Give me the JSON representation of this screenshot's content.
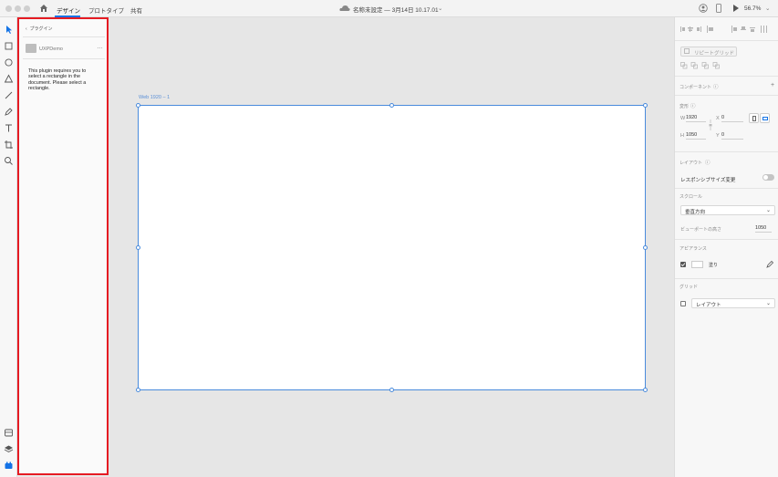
{
  "titlebar": {
    "tabs": [
      {
        "label": "デザイン",
        "active": true
      },
      {
        "label": "プロトタイプ",
        "active": false
      },
      {
        "label": "共有",
        "active": false
      }
    ],
    "doc_title": "名称未設定 — 3月14日 10.17.01",
    "zoom": "56.7%"
  },
  "toolbar": {
    "tools": [
      "select-icon",
      "rectangle-icon",
      "ellipse-icon",
      "polygon-icon",
      "line-icon",
      "pen-icon",
      "text-icon",
      "artboard-icon",
      "zoom-icon"
    ],
    "bottom_tools": [
      "assets-icon",
      "layers-icon",
      "plugins-icon"
    ]
  },
  "plugin_panel": {
    "back_label": "プラグイン",
    "plugin_name": "UXPDemo",
    "more": "…",
    "message": "This plugin requires you to select a rectangle in the document. Please select a rectangle."
  },
  "canvas": {
    "artboard_label": "Web 1920 – 1"
  },
  "right_panel": {
    "repeat_grid_label": "リピートグリッド",
    "component_label": "コンポーネント",
    "transform_label": "変形",
    "w_label": "W",
    "w_value": "1920",
    "h_label": "H",
    "h_value": "1050",
    "x_label": "X",
    "x_value": "0",
    "y_label": "Y",
    "y_value": "0",
    "layout_label": "レイアウト",
    "responsive_label": "レスポンシブサイズ変更",
    "scroll_label": "スクロール",
    "scroll_value": "垂直方向",
    "viewport_label": "ビューポートの高さ",
    "viewport_value": "1050",
    "appearance_label": "アピアランス",
    "fill_label": "塗り",
    "grid_label": "グリッド",
    "grid_value": "レイアウト"
  },
  "colors": {
    "accent": "#1473e6",
    "highlight_border": "#e51b23",
    "artboard_border": "#4a8bdc"
  }
}
